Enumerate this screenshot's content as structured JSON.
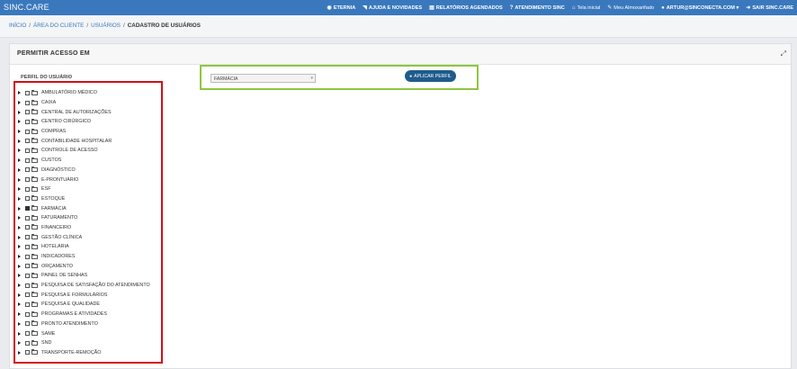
{
  "app": {
    "brand": "SINC.CARE"
  },
  "topnav": [
    {
      "name": "nav-eternia",
      "icon": "eye-icon",
      "glyph": "◉",
      "label": "ETERNIA"
    },
    {
      "name": "nav-ajuda-novidades",
      "icon": "rss-icon",
      "glyph": "◥",
      "label": "AJUDA E NOVIDADES"
    },
    {
      "name": "nav-relatorios-agendados",
      "icon": "list-icon",
      "glyph": "▤",
      "label": "RELATÓRIOS AGENDADOS"
    },
    {
      "name": "nav-atendimento-sinc",
      "icon": "question-icon",
      "glyph": "?",
      "label": "ATENDIMENTO SINC"
    },
    {
      "name": "nav-tela-inicial",
      "icon": "home-icon",
      "glyph": "⌂",
      "label": "Tela inicial",
      "light": true
    },
    {
      "name": "nav-meu-almoxarifado",
      "icon": "edit-icon",
      "glyph": "✎",
      "label": "Meu Almoxarifado",
      "light": true
    },
    {
      "name": "nav-user-menu",
      "icon": "user-icon",
      "glyph": "●",
      "label": "ARTUR@SINCONECTA.COM ▾"
    },
    {
      "name": "nav-sair",
      "icon": "logout-icon",
      "glyph": "➜",
      "label": "SAIR SINC.CARE"
    }
  ],
  "breadcrumb": {
    "inicio": "INÍCIO",
    "area": "ÁREA DO CLIENTE",
    "usuarios": "USUÁRIOS",
    "current": "CADASTRO DE USUÁRIOS",
    "separator": "/"
  },
  "panel": {
    "title": "PERMITIR ACESSO EM",
    "perfil_label": "PERFIL DO USUÁRIO",
    "profile_value": "FARMÁCIA",
    "apply_label": "APLICAR PERFIL",
    "apply_icon": "user-lock-icon"
  },
  "tree_items": [
    {
      "label": "AMBULATÓRIO MÉDICO",
      "checked": false
    },
    {
      "label": "CAIXA",
      "checked": false
    },
    {
      "label": "CENTRAL DE AUTORIZAÇÕES",
      "checked": false
    },
    {
      "label": "CENTRO CIRÚRGICO",
      "checked": false
    },
    {
      "label": "COMPRAS",
      "checked": false
    },
    {
      "label": "CONTABILIDADE HOSPITALAR",
      "checked": false
    },
    {
      "label": "CONTROLE DE ACESSO",
      "checked": false
    },
    {
      "label": "CUSTOS",
      "checked": false
    },
    {
      "label": "DIAGNÓSTICO",
      "checked": false
    },
    {
      "label": "E-PRONTUÁRIO",
      "checked": false
    },
    {
      "label": "ESF",
      "checked": false
    },
    {
      "label": "ESTOQUE",
      "checked": false
    },
    {
      "label": "FARMÁCIA",
      "checked": true
    },
    {
      "label": "FATURAMENTO",
      "checked": false
    },
    {
      "label": "FINANCEIRO",
      "checked": false
    },
    {
      "label": "GESTÃO CLÍNICA",
      "checked": false
    },
    {
      "label": "HOTELARIA",
      "checked": false
    },
    {
      "label": "INDICADORES",
      "checked": false
    },
    {
      "label": "ORÇAMENTO",
      "checked": false
    },
    {
      "label": "PAINEL DE SENHAS",
      "checked": false
    },
    {
      "label": "PESQUISA DE SATISFAÇÃO DO ATENDIMENTO",
      "checked": false
    },
    {
      "label": "PESQUISA E FORMULÁRIOS",
      "checked": false
    },
    {
      "label": "PESQUISA E QUALIDADE",
      "checked": false
    },
    {
      "label": "PROGRAMAS E ATIVIDADES",
      "checked": false
    },
    {
      "label": "PRONTO ATENDIMENTO",
      "checked": false
    },
    {
      "label": "SAME",
      "checked": false
    },
    {
      "label": "SND",
      "checked": false
    },
    {
      "label": "TRANSPORTE-REMOÇÃO",
      "checked": false
    }
  ],
  "colors": {
    "topbar": "#3a78bd",
    "button": "#1f5b8c",
    "highlight_red": "#d30f16",
    "highlight_green": "#8dc641"
  }
}
